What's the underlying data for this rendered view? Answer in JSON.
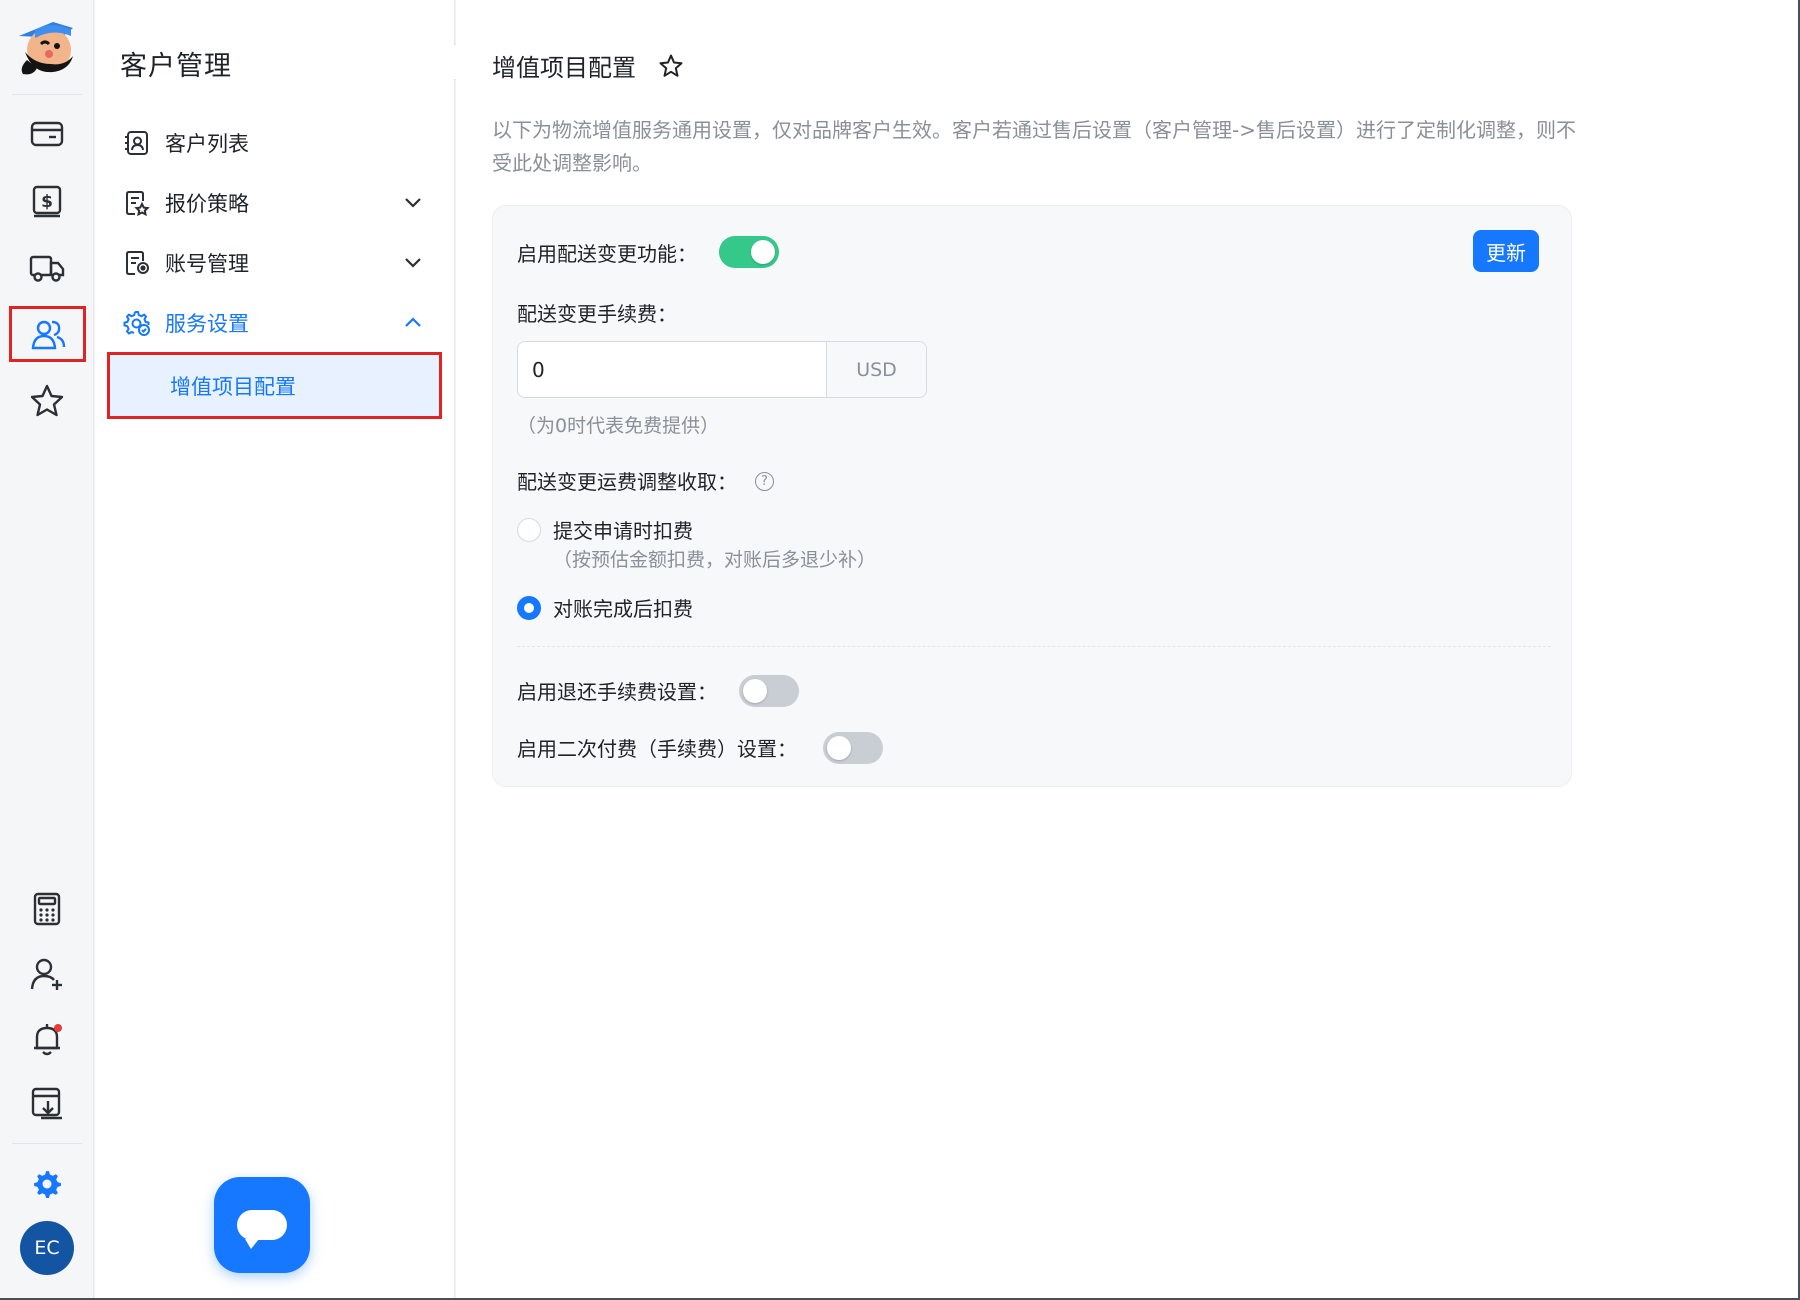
{
  "rail": {
    "avatar_text": "EC",
    "items": [
      {
        "name": "card",
        "icon": "wallet-icon"
      },
      {
        "name": "billing",
        "icon": "dollar-icon"
      },
      {
        "name": "shipping",
        "icon": "truck-icon"
      },
      {
        "name": "customers",
        "icon": "users-icon",
        "active": true
      },
      {
        "name": "favorites",
        "icon": "star-icon"
      },
      {
        "name": "calculator",
        "icon": "calculator-icon"
      },
      {
        "name": "add-user",
        "icon": "add-user-icon"
      },
      {
        "name": "notifications",
        "icon": "bell-icon"
      },
      {
        "name": "download",
        "icon": "download-icon"
      },
      {
        "name": "settings",
        "icon": "gear-icon"
      }
    ]
  },
  "subnav": {
    "title": "客户管理",
    "items": [
      {
        "label": "客户列表",
        "icon": "contact-book-icon"
      },
      {
        "label": "报价策略",
        "icon": "quote-doc-icon",
        "expandable": true
      },
      {
        "label": "账号管理",
        "icon": "account-doc-icon",
        "expandable": true
      },
      {
        "label": "服务设置",
        "icon": "service-gear-icon",
        "expanded": true
      }
    ],
    "active_sub": "增值项目配置"
  },
  "main": {
    "title": "增值项目配置",
    "description": "以下为物流增值服务通用设置，仅对品牌客户生效。客户若通过售后设置（客户管理->售后设置）进行了定制化调整，则不受此处调整影响。",
    "enable_change_label": "启用配送变更功能：",
    "enable_change_on": true,
    "update_label": "更新",
    "fee_label": "配送变更手续费：",
    "fee_value": "0",
    "fee_unit": "USD",
    "fee_hint": "（为0时代表免费提供）",
    "freight_label": "配送变更运费调整收取：",
    "help_glyph": "?",
    "options": [
      {
        "label": "提交申请时扣费",
        "sub": "（按预估金额扣费，对账后多退少补）",
        "checked": false
      },
      {
        "label": "对账完成后扣费",
        "sub": "",
        "checked": true
      }
    ],
    "refund_label": "启用退还手续费设置：",
    "refund_on": false,
    "second_pay_label": "启用二次付费（手续费）设置：",
    "second_pay_on": false
  },
  "colors": {
    "accent": "#1677ff",
    "toggle_on": "#34c98a",
    "highlight_border": "#e02424",
    "avatar_bg": "#1354a3"
  }
}
